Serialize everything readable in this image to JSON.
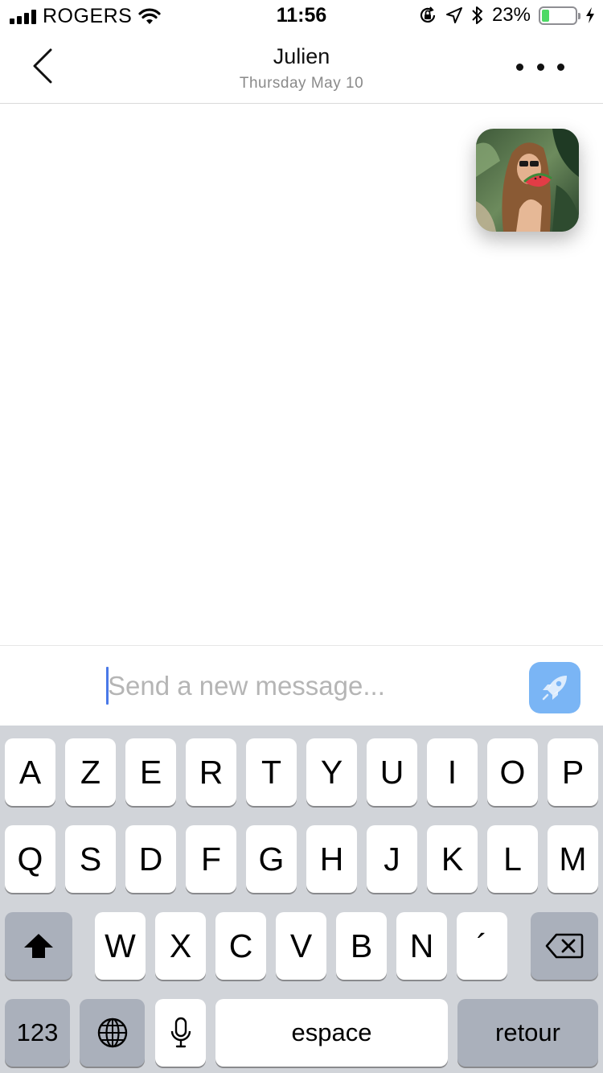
{
  "status_bar": {
    "carrier": "ROGERS",
    "time": "11:56",
    "battery_percent": "23%",
    "battery_level": 0.23,
    "icons": [
      "signal-bars-icon",
      "wifi-icon",
      "orientation-lock-icon",
      "location-arrow-icon",
      "bluetooth-icon",
      "battery-icon",
      "charging-bolt-icon"
    ]
  },
  "header": {
    "title": "Julien",
    "subtitle": "Thursday May 10",
    "back_icon": "chevron-left-icon",
    "more_icon": "more-dots-icon"
  },
  "chat": {
    "messages": [
      {
        "type": "photo",
        "description_icon": "photo-thumbnail"
      }
    ]
  },
  "composer": {
    "placeholder": "Send a new message...",
    "value": "",
    "send_icon": "rocket-icon",
    "send_color": "#7ab5f5",
    "caret_color": "#4a79e8"
  },
  "keyboard": {
    "row1": [
      "A",
      "Z",
      "E",
      "R",
      "T",
      "Y",
      "U",
      "I",
      "O",
      "P"
    ],
    "row2": [
      "Q",
      "S",
      "D",
      "F",
      "G",
      "H",
      "J",
      "K",
      "L",
      "M"
    ],
    "row3": [
      "W",
      "X",
      "C",
      "V",
      "B",
      "N",
      "´"
    ],
    "numbers_label": "123",
    "space_label": "espace",
    "return_label": "retour",
    "icons": [
      "shift-icon",
      "backspace-icon",
      "globe-icon",
      "microphone-icon"
    ]
  }
}
